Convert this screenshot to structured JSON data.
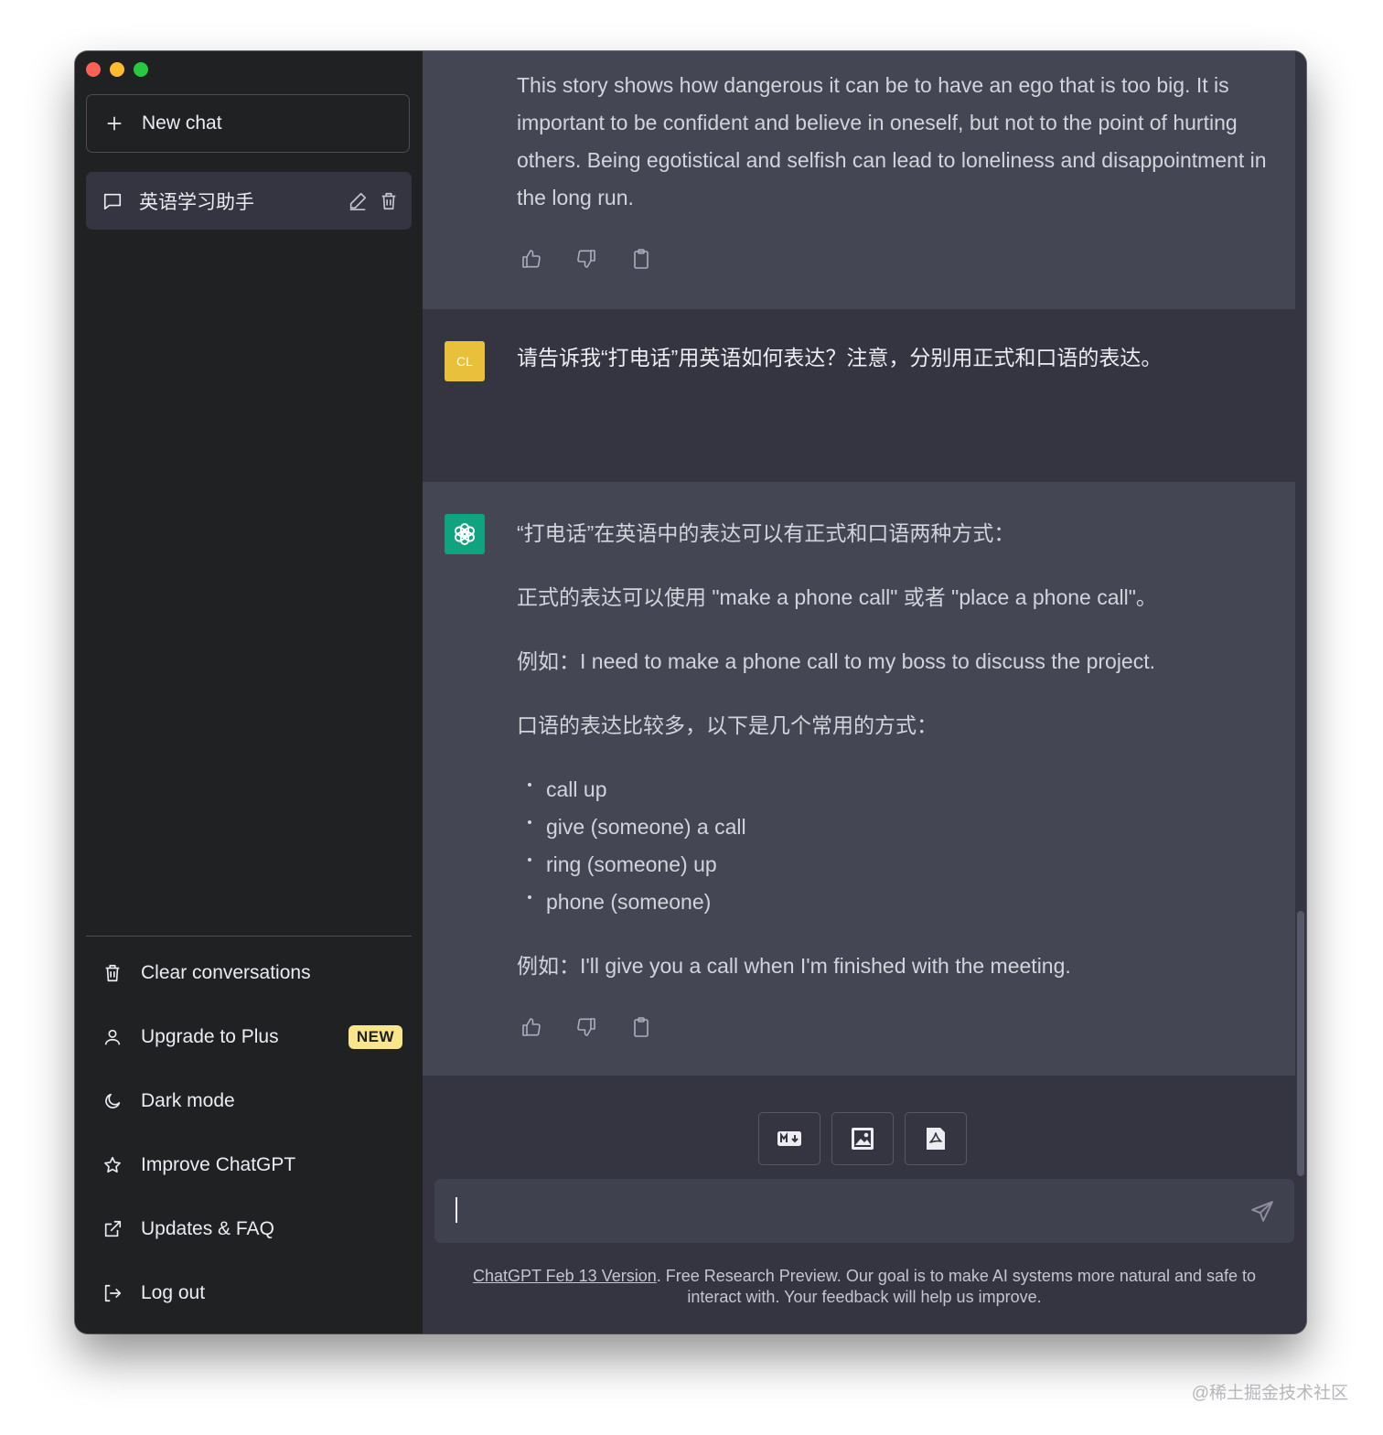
{
  "sidebar": {
    "new_chat_label": "New chat",
    "conversations": [
      {
        "title": "英语学习助手"
      }
    ],
    "menu": {
      "clear": "Clear conversations",
      "upgrade": "Upgrade to Plus",
      "upgrade_badge": "NEW",
      "dark_mode": "Dark mode",
      "improve": "Improve ChatGPT",
      "updates": "Updates & FAQ",
      "logout": "Log out"
    }
  },
  "messages": {
    "m1": {
      "role": "assistant",
      "text": "This story shows how dangerous it can be to have an ego that is too big. It is important to be confident and believe in oneself, but not to the point of hurting others. Being egotistical and selfish can lead to loneliness and disappointment in the long run."
    },
    "m2": {
      "role": "user",
      "avatar_initials": "CL",
      "text": "请告诉我“打电话”用英语如何表达？注意，分别用正式和口语的表达。"
    },
    "m3": {
      "role": "assistant",
      "intro": "“打电话”在英语中的表达可以有正式和口语两种方式：",
      "formal": "正式的表达可以使用 \"make a phone call\" 或者 \"place a phone call\"。",
      "formal_example": "例如：I need to make a phone call to my boss to discuss the project.",
      "colloquial": "口语的表达比较多，以下是几个常用的方式：",
      "bullets": [
        "call up",
        "give (someone) a call",
        "ring (someone) up",
        "phone (someone)"
      ],
      "colloquial_example": "例如：I'll give you a call when I'm finished with the meeting."
    }
  },
  "composer": {
    "value": ""
  },
  "footer": {
    "version_link": "ChatGPT Feb 13 Version",
    "note": ". Free Research Preview. Our goal is to make AI systems more natural and safe to interact with. Your feedback will help us improve."
  },
  "watermark": "@稀土掘金技术社区",
  "colors": {
    "sidebar_bg": "#202123",
    "main_bg": "#343541",
    "ai_msg_bg": "#444654",
    "user_avatar": "#e9c03a",
    "bot_avatar": "#10a37f",
    "badge": "#f9e58a"
  },
  "icons": [
    "plus-icon",
    "chat-bubble-icon",
    "edit-icon",
    "trash-icon",
    "user-icon",
    "moon-icon",
    "star-icon",
    "external-link-icon",
    "logout-icon",
    "thumbs-up-icon",
    "thumbs-down-icon",
    "clipboard-icon",
    "markdown-icon",
    "image-icon",
    "pdf-icon",
    "send-icon",
    "openai-logo-icon"
  ]
}
